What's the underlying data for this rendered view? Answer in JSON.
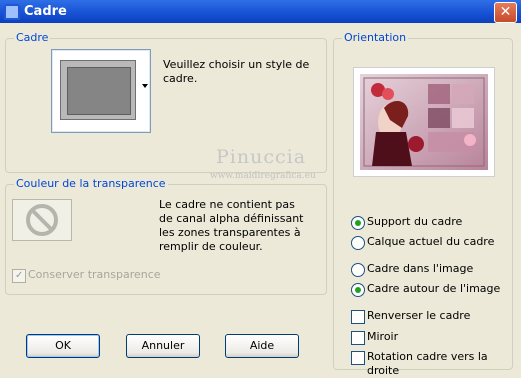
{
  "title": "Cadre",
  "icons": {
    "app": "app-icon",
    "close": "close-icon",
    "no_transparency": "no-entry-icon",
    "dropdown": "chevron-down-icon",
    "check": "check-icon"
  },
  "colors": {
    "accent_text": "#0046d5",
    "radio_selected": "#21a121"
  },
  "cadre": {
    "legend": "Cadre",
    "instruction": "Veuillez choisir un style de cadre."
  },
  "transparency": {
    "legend": "Couleur de la transparence",
    "description": "Le cadre ne contient pas de canal alpha définissant les zones transparentes à remplir de couleur.",
    "keep_label": "Conserver transparence",
    "keep_checked": true,
    "keep_enabled": false
  },
  "watermark": {
    "name": "Pinuccia",
    "site": "www.maidiregrafica.eu"
  },
  "orientation": {
    "legend": "Orientation",
    "radios_group1": [
      {
        "label": "Support du cadre",
        "selected": true
      },
      {
        "label": "Calque actuel du cadre",
        "selected": false
      }
    ],
    "radios_group2": [
      {
        "label": "Cadre dans l'image",
        "selected": false
      },
      {
        "label": "Cadre autour de l'image",
        "selected": true
      }
    ],
    "checkboxes": [
      {
        "label": "Renverser le cadre",
        "checked": false
      },
      {
        "label": "Miroir",
        "checked": false
      },
      {
        "label": "Rotation cadre vers la droite",
        "checked": false
      }
    ]
  },
  "buttons": {
    "ok": "OK",
    "cancel": "Annuler",
    "help": "Aide"
  }
}
